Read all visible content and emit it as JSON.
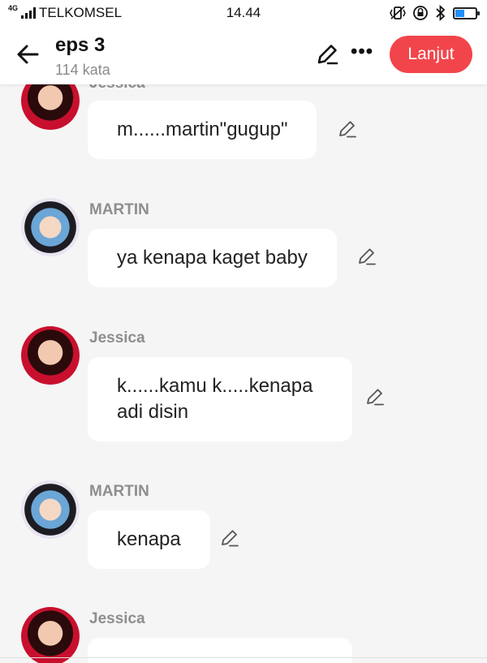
{
  "status_bar": {
    "network_type": "4G",
    "carrier": "TELKOMSEL",
    "time": "14.44",
    "battery_color": "#1e90ff"
  },
  "header": {
    "title": "eps 3",
    "word_count": "114 kata",
    "next_label": "Lanjut",
    "more_label": "•••",
    "accent_color": "#f2454b"
  },
  "messages": [
    {
      "sender": "Jessica",
      "text": "m......martin\"gugup\""
    },
    {
      "sender": "MARTIN",
      "text": "ya kenapa kaget baby"
    },
    {
      "sender": "Jessica",
      "text": "k......kamu k.....kenapa adi disin"
    },
    {
      "sender": "MARTIN",
      "text": "kenapa"
    },
    {
      "sender": "Jessica",
      "text": ""
    }
  ]
}
